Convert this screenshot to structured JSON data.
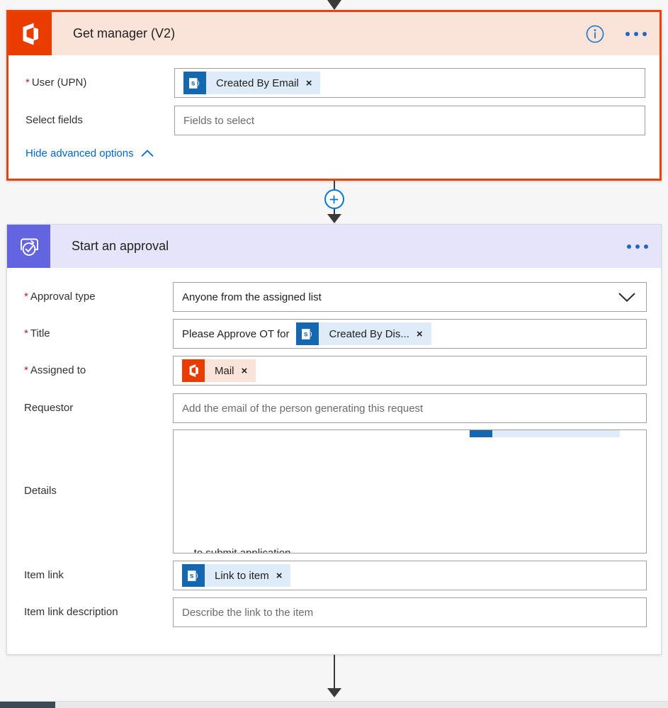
{
  "flow": {
    "cards": [
      {
        "id": "get-manager",
        "title": "Get manager (V2)",
        "icon": "office365-users-icon",
        "selected": true,
        "fields": [
          {
            "label": "User (UPN)",
            "required": true,
            "type": "token",
            "token": {
              "icon": "sharepoint-icon",
              "text": "Created By Email",
              "remove": "×"
            }
          },
          {
            "label": "Select fields",
            "required": false,
            "type": "text",
            "placeholder": "Fields to select",
            "value": ""
          }
        ],
        "advanced_link": "Hide advanced options",
        "advanced_chevron": "chevron-up-icon"
      },
      {
        "id": "start-approval",
        "title": "Start an approval",
        "icon": "approvals-icon",
        "selected": false,
        "fields": [
          {
            "label": "Approval type",
            "required": true,
            "type": "select",
            "value": "Anyone from the assigned list",
            "chevron": "chevron-down-icon"
          },
          {
            "label": "Title",
            "required": true,
            "type": "text-with-token",
            "prefix": "Please Approve OT for",
            "token": {
              "icon": "sharepoint-icon",
              "text": "Created By Dis...",
              "remove": "×"
            }
          },
          {
            "label": "Assigned to",
            "required": true,
            "type": "token",
            "token": {
              "icon": "office365-icon",
              "text": "Mail",
              "remove": "×"
            }
          },
          {
            "label": "Requestor",
            "required": false,
            "type": "text",
            "placeholder": "Add the email of the person generating this request",
            "value": ""
          },
          {
            "label": "Details",
            "required": false,
            "type": "textarea",
            "clipped_bottom_text": "... to submit application..."
          },
          {
            "label": "Item link",
            "required": false,
            "type": "token",
            "token": {
              "icon": "sharepoint-icon",
              "text": "Link to item",
              "remove": "×"
            }
          },
          {
            "label": "Item link description",
            "required": false,
            "type": "text",
            "placeholder": "Describe the link to the item",
            "value": ""
          }
        ]
      }
    ],
    "connector": {
      "add_step_label": "+",
      "add_step_icon": "plus-circle-icon"
    },
    "header_actions": {
      "info_icon": "info-circle-icon",
      "more_icon": "more-menu-icon"
    }
  },
  "colors": {
    "selection_border": "#e8430f",
    "office_orange": "#eb3c00",
    "approval_purple": "#6264e0",
    "sharepoint_blue": "#1567b0",
    "link_blue": "#0066cc",
    "accent_blue": "#0078d4",
    "required_red": "#a4262c",
    "get_manager_header_bg": "#fae3d9",
    "approval_header_bg": "#e6e4fa",
    "canvas_bg": "#f6f6f6"
  }
}
